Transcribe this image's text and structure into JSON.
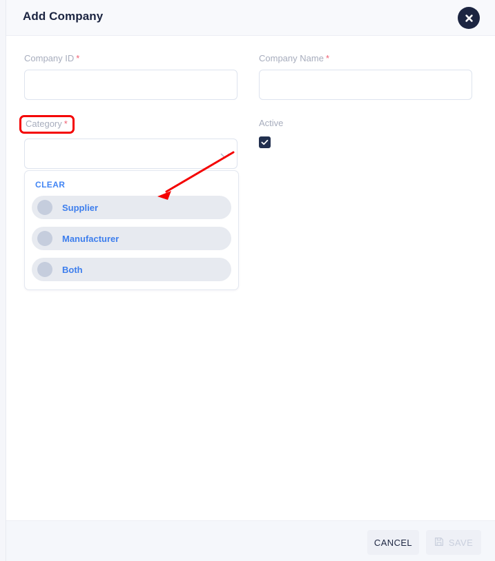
{
  "header": {
    "title": "Add Company",
    "close_icon": "close-icon"
  },
  "form": {
    "company_id": {
      "label": "Company ID",
      "required_marker": "*",
      "value": "",
      "placeholder": ""
    },
    "company_name": {
      "label": "Company Name",
      "required_marker": "*",
      "value": "",
      "placeholder": ""
    },
    "category": {
      "label": "Category",
      "required_marker": "*",
      "value": "",
      "chevron_icon": "chevron-down-icon",
      "highlighted": true
    },
    "active": {
      "label": "Active",
      "checked": true,
      "check_icon": "check-icon"
    }
  },
  "dropdown": {
    "clear_label": "CLEAR",
    "options": [
      {
        "label": "Supplier"
      },
      {
        "label": "Manufacturer"
      },
      {
        "label": "Both"
      }
    ]
  },
  "footer": {
    "cancel_label": "CANCEL",
    "save_label": "SAVE",
    "save_icon": "save-disk-icon",
    "save_disabled": true
  },
  "colors": {
    "title": "#1c2541",
    "label": "#a7adbd",
    "required": "#ef5f72",
    "accent_blue": "#3d7eed",
    "clear_blue": "#4285f4",
    "annotation_red": "#f40000",
    "checkbox": "#22304f",
    "header_bg": "#f8f9fc",
    "footer_bg": "#f5f7fb"
  }
}
